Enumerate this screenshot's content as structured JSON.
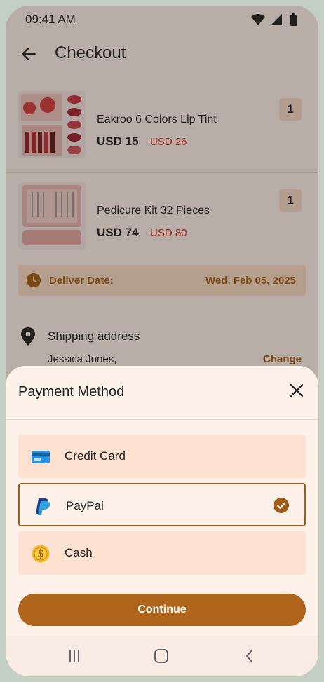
{
  "status": {
    "time": "09:41 AM"
  },
  "header": {
    "title": "Checkout"
  },
  "products": [
    {
      "name": "Eakroo 6 Colors Lip Tint",
      "price": "USD 15",
      "old_price": "USD 26",
      "qty": "1"
    },
    {
      "name": "Pedicure Kit 32 Pieces",
      "price": "USD 74",
      "old_price": "USD 80",
      "qty": "1"
    }
  ],
  "delivery": {
    "label": "Deliver Date:",
    "value": "Wed, Feb 05, 2025"
  },
  "shipping": {
    "title": "Shipping address",
    "name": "Jessica Jones,",
    "change": "Change"
  },
  "payment_sheet": {
    "title": "Payment Method",
    "options": [
      {
        "label": "Credit Card",
        "icon": "credit-card-icon",
        "selected": false
      },
      {
        "label": "PayPal",
        "icon": "paypal-icon",
        "selected": true
      },
      {
        "label": "Cash",
        "icon": "cash-coin-icon",
        "selected": false
      }
    ],
    "continue_label": "Continue"
  },
  "colors": {
    "accent": "#b0651d",
    "accent_text": "#a35a14",
    "surface": "#fdf1ea",
    "option_bg": "#fde2d2"
  }
}
